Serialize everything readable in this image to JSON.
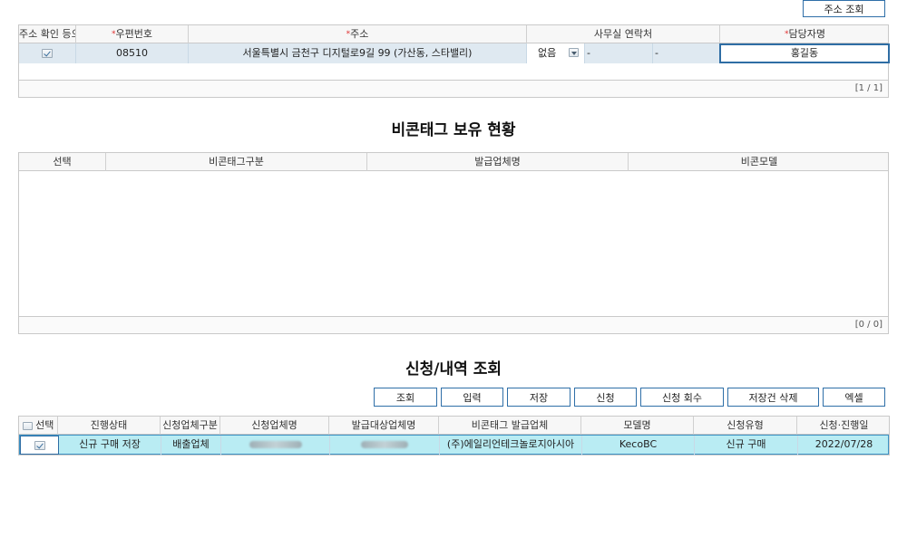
{
  "top": {
    "address_search_label": "주소 조회"
  },
  "address_grid": {
    "headers": {
      "confirm": "주소 확인 등으",
      "postal": "우편번호",
      "address": "주소",
      "office_contact": "사무실 연락처",
      "manager": "담당자명"
    },
    "required_mark": "*",
    "row": {
      "postal": "08510",
      "address": "서울특별시 금천구  디지털로9길 99 (가산동, 스타밸리)",
      "phone_select": "없음",
      "phone_dash1": "-",
      "phone_dash2": "-",
      "manager": "홍길동"
    },
    "paging": "[1 / 1]"
  },
  "beacon_section": {
    "title": "비콘태그 보유 현황",
    "headers": [
      "선택",
      "비콘태그구분",
      "발급업체명",
      "비콘모델"
    ],
    "paging": "[0 / 0]"
  },
  "request_section": {
    "title": "신청/내역 조회",
    "buttons": [
      "조회",
      "입력",
      "저장",
      "신청",
      "신청 회수",
      "저장건 삭제",
      "엑셀"
    ],
    "headers": [
      "선택",
      "진행상태",
      "신청업체구분",
      "신청업체명",
      "발급대상업체명",
      "비콘태그 발급업체",
      "모델명",
      "신청유형",
      "신청·진행일"
    ],
    "row": {
      "status": "신규 구매 저장",
      "company_type": "배출업체",
      "issuer": "(주)에일리언테크놀로지아시아",
      "model": "KecoBC",
      "request_type": "신규 구매",
      "date": "2022/07/28"
    }
  }
}
